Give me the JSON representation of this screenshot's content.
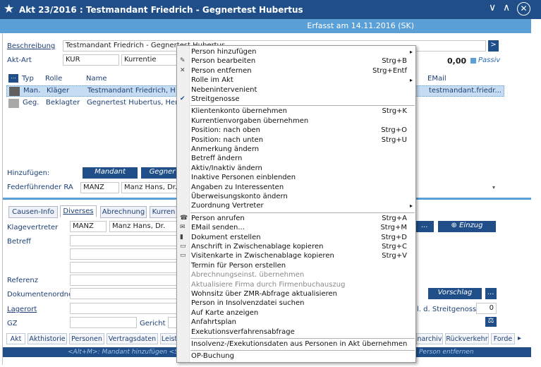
{
  "window": {
    "title": "Akt 23/2016 : Testmandant Friedrich - Gegnertest Hubertus",
    "erfasst": "Erfasst am 14.11.2016 (SK)"
  },
  "form": {
    "beschreibung_label": "Beschreibung",
    "beschreibung_value": "Testmandant Friedrich - Gegnertest Hubertus",
    "akt_art_label": "Akt-Art",
    "akt_art_value": "KUR",
    "kurrentie_value": "Kurrentie",
    "amount": "0,00",
    "passiv": "Passiv",
    "go_button": ">"
  },
  "grid": {
    "headers": [
      "...",
      "Typ",
      "Rolle",
      "Name",
      "EMail"
    ],
    "rows": [
      {
        "typ": "Man.",
        "rolle": "Kläger",
        "name": "Testmandant Friedrich, H",
        "email": "testmandant.friedr...",
        "selected": true,
        "color": "#606060"
      },
      {
        "typ": "Geg.",
        "rolle": "Beklagter",
        "name": "Gegnertest Hubertus, Herr",
        "email": "",
        "selected": false,
        "color": "#a8a8a8"
      }
    ]
  },
  "hinzufuegen": {
    "label": "Hinzufügen:",
    "mandant": "Mandant",
    "gegner": "Gegner"
  },
  "federfuehrend": {
    "label": "Federführender RA",
    "code": "MANZ",
    "name": "Manz Hans, Dr."
  },
  "tabs": [
    "Causen-Info",
    "Diverses",
    "Abrechnung",
    "Kurren"
  ],
  "diverses": {
    "klagevertreter_label": "Klagevertreter",
    "klagevertreter_code": "MANZ",
    "klagevertreter_name": "Manz Hans, Dr.",
    "einzug": "Einzug",
    "betreff": "Betreff",
    "referenz": "Referenz",
    "dokumentenordner": "Dokumentenordner",
    "vorschlag": "Vorschlag",
    "lagerort": "Lagerort",
    "streitgenossen": "l. d. Streitgenossen",
    "streitgenossen_value": "0",
    "gz": "GZ",
    "gericht": "Gericht",
    "dots": "..."
  },
  "bottom_tabs": [
    "Akt",
    "Akthistorie",
    "Personen",
    "Vertragsdaten",
    "Leist",
    "narchiv",
    "Rückverkehr",
    "Forde"
  ],
  "hint": "<Alt+M>: Mandant hinzufügen <Stra",
  "hint_right": "Person entfernen",
  "menu": [
    {
      "label": "Person hinzufügen",
      "shortcut": "",
      "sub": true,
      "disabled": false,
      "icon": ""
    },
    {
      "label": "Person bearbeiten",
      "shortcut": "Strg+B",
      "sub": false,
      "disabled": false,
      "icon": "edit-icon"
    },
    {
      "label": "Person entfernen",
      "shortcut": "Strg+Entf",
      "sub": false,
      "disabled": false,
      "icon": "delete-icon"
    },
    {
      "label": "Rolle im Akt",
      "shortcut": "",
      "sub": true,
      "disabled": false,
      "icon": ""
    },
    {
      "label": "Nebenintervenient",
      "shortcut": "",
      "sub": false,
      "disabled": false,
      "icon": ""
    },
    {
      "label": "Streitgenosse",
      "shortcut": "",
      "sub": false,
      "disabled": false,
      "icon": "check-icon"
    },
    {
      "label": "Klientenkonto übernehmen",
      "shortcut": "Strg+K",
      "sub": false,
      "disabled": false,
      "icon": "",
      "sep_before": true
    },
    {
      "label": "Kurrentienvorgaben übernehmen",
      "shortcut": "",
      "sub": false,
      "disabled": false,
      "icon": ""
    },
    {
      "label": "Position: nach oben",
      "shortcut": "Strg+O",
      "sub": false,
      "disabled": false,
      "icon": ""
    },
    {
      "label": "Position: nach unten",
      "shortcut": "Strg+U",
      "sub": false,
      "disabled": false,
      "icon": ""
    },
    {
      "label": "Anmerkung ändern",
      "shortcut": "",
      "sub": false,
      "disabled": false,
      "icon": ""
    },
    {
      "label": "Betreff ändern",
      "shortcut": "",
      "sub": false,
      "disabled": false,
      "icon": ""
    },
    {
      "label": "Aktiv/Inaktiv ändern",
      "shortcut": "",
      "sub": false,
      "disabled": false,
      "icon": ""
    },
    {
      "label": "Inaktive Personen einblenden",
      "shortcut": "",
      "sub": false,
      "disabled": false,
      "icon": ""
    },
    {
      "label": "Angaben zu Interessenten",
      "shortcut": "",
      "sub": false,
      "disabled": false,
      "icon": ""
    },
    {
      "label": "Überweisungskonto ändern",
      "shortcut": "",
      "sub": false,
      "disabled": false,
      "icon": ""
    },
    {
      "label": "Zuordnung Vertreter",
      "shortcut": "",
      "sub": true,
      "disabled": false,
      "icon": ""
    },
    {
      "label": "Person anrufen",
      "shortcut": "Strg+A",
      "sub": false,
      "disabled": false,
      "icon": "phone-icon",
      "sep_before": true
    },
    {
      "label": "EMail senden...",
      "shortcut": "Strg+M",
      "sub": false,
      "disabled": false,
      "icon": "mail-icon"
    },
    {
      "label": "Dokument erstellen",
      "shortcut": "Strg+D",
      "sub": false,
      "disabled": false,
      "icon": "document-icon"
    },
    {
      "label": "Anschrift in Zwischenablage kopieren",
      "shortcut": "Strg+C",
      "sub": false,
      "disabled": false,
      "icon": "card-icon"
    },
    {
      "label": "Visitenkarte in Zwischenablage kopieren",
      "shortcut": "Strg+V",
      "sub": false,
      "disabled": false,
      "icon": "card-icon"
    },
    {
      "label": "Termin für Person erstellen",
      "shortcut": "",
      "sub": false,
      "disabled": false,
      "icon": ""
    },
    {
      "label": "Abrechnungseinst. übernehmen",
      "shortcut": "",
      "sub": false,
      "disabled": true,
      "icon": ""
    },
    {
      "label": "Aktualisiere Firma durch Firmenbuchauszug",
      "shortcut": "",
      "sub": false,
      "disabled": true,
      "icon": ""
    },
    {
      "label": "Wohnsitz über ZMR-Abfrage aktualisieren",
      "shortcut": "",
      "sub": false,
      "disabled": false,
      "icon": ""
    },
    {
      "label": "Person in Insolvenzdatei suchen",
      "shortcut": "",
      "sub": false,
      "disabled": false,
      "icon": ""
    },
    {
      "label": "Auf Karte anzeigen",
      "shortcut": "",
      "sub": false,
      "disabled": false,
      "icon": ""
    },
    {
      "label": "Anfahrtsplan",
      "shortcut": "",
      "sub": false,
      "disabled": false,
      "icon": ""
    },
    {
      "label": "Exekutionsverfahrensabfrage",
      "shortcut": "",
      "sub": false,
      "disabled": false,
      "icon": ""
    },
    {
      "label": "Insolvenz-/Exekutionsdaten aus Personen in Akt übernehmen",
      "shortcut": "",
      "sub": false,
      "disabled": false,
      "icon": "",
      "sep_before": true
    },
    {
      "label": "OP-Buchung",
      "shortcut": "",
      "sub": false,
      "disabled": false,
      "icon": "",
      "sep_before": true
    }
  ],
  "colors": {
    "titlebar": "#1f4e89",
    "erfasst": "#5aa0d6",
    "selection": "#c5dcf2",
    "label": "#1e3f75"
  }
}
